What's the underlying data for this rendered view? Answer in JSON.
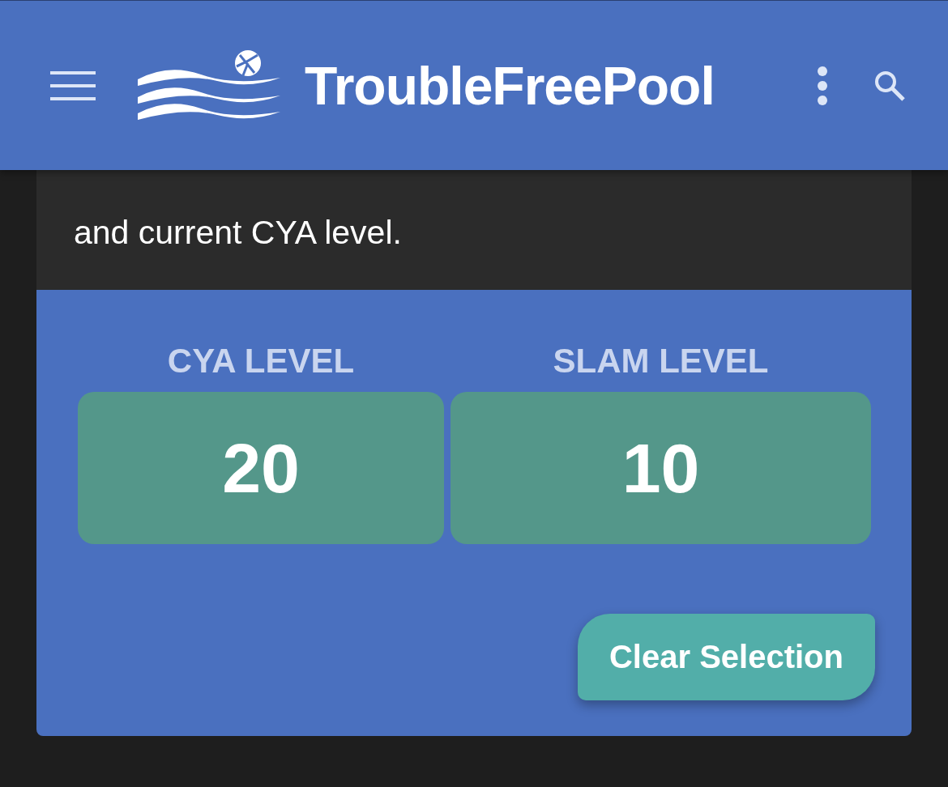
{
  "header": {
    "brand": "TroubleFreePool"
  },
  "intro": {
    "text": "and current CYA level."
  },
  "levels": [
    {
      "label": "CYA LEVEL",
      "value": "20"
    },
    {
      "label": "SLAM LEVEL",
      "value": "10"
    }
  ],
  "clear_button": {
    "label": "Clear Selection"
  }
}
